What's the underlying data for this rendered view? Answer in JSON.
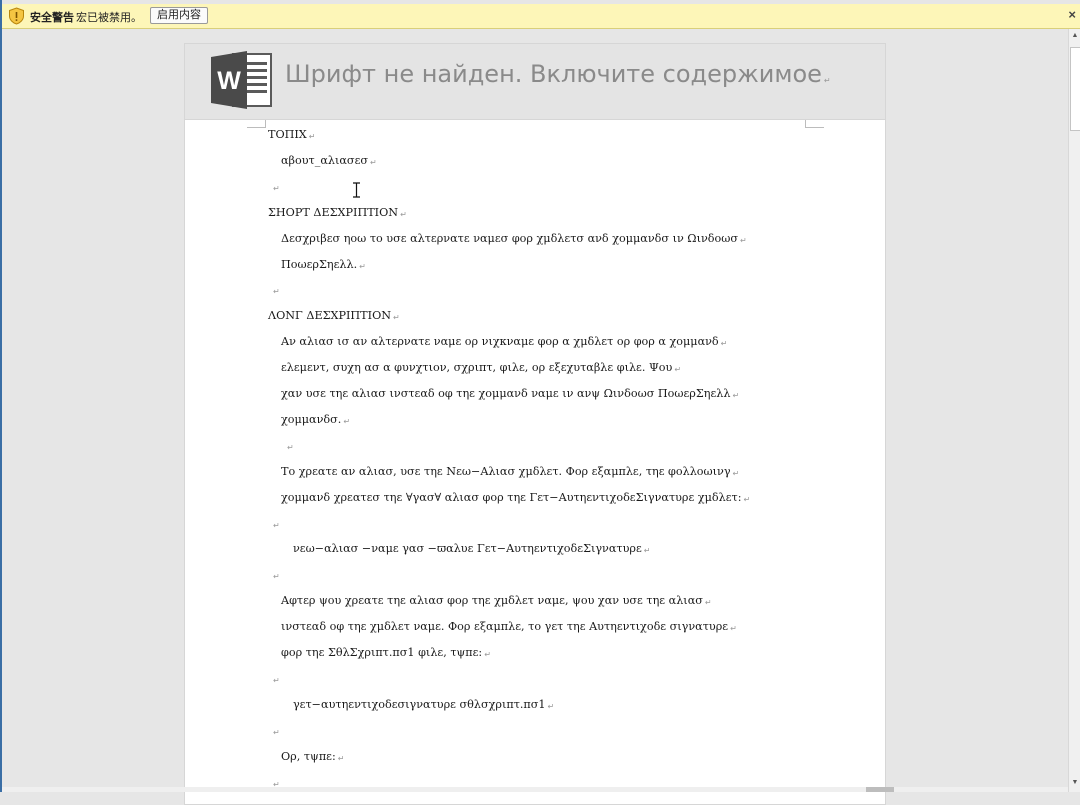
{
  "security_bar": {
    "title": "安全警告",
    "message": "宏已被禁用。",
    "enable_label": "启用内容",
    "close_glyph": "×",
    "icon": "shield-warning-icon"
  },
  "banner": {
    "text": "Шрифт не найден. Включите содержимое",
    "logo_letter": "W",
    "icon": "word-logo-icon"
  },
  "document": {
    "paragraph_mark": "↵",
    "lines": [
      "ΤΟΠΙΧ",
      "αβουτ_αλιασεσ",
      "",
      "ΣΗΟΡΤ ΔΕΣΧΡΙΠΤΙΟΝ",
      "Δεσχριβεσ ηοω το υσε αλτερνατε ναμεσ φορ χμδλετσ ανδ χομμανδσ ιν Ωινδοωσ",
      "ΠοωερΣηελλ.",
      "",
      "ΛΟΝΓ ΔΕΣΧΡΙΠΤΙΟΝ",
      "Αν αλιασ ισ αν αλτερνατε ναμε ορ νιχκναμε φορ α χμδλετ ορ φορ α χομμανδ",
      "ελεμεντ, συχη ασ α φυνχτιον, σχριπτ, φιλε, ορ εξεχυταβλε φιλε. Ψου",
      "χαν υσε τηε αλιασ ινστεαδ οφ τηε χομμανδ ναμε ιν ανψ Ωινδοωσ ΠοωερΣηελλ",
      "χομμανδσ.",
      "",
      "Το χρεατε αν αλιασ, υσε τηε Νεω−Αλιασ χμδλετ. Φορ εξαμπλε, τηε φολλοωινγ",
      "χομμανδ χρεατεσ τηε ∀γασ∀ αλιασ φορ τηε Γετ−ΑυτηεντιχοδεΣιγνατυρε χμδλετ:",
      "",
      "νεω−αλιασ −ναμε γασ −ϖαλυε Γετ−ΑυτηεντιχοδεΣιγνατυρε",
      "",
      "Αφτερ ψου χρεατε τηε αλιασ φορ τηε χμδλετ ναμε, ψου χαν υσε τηε αλιασ",
      "ινστεαδ οφ τηε χμδλετ ναμε. Φορ εξαμπλε, το γετ τηε Αυτηεντιχοδε σιγνατυρε",
      "φορ τηε ΣθλΣχριπτ.πσ1 φιλε, τψπε:",
      "",
      "γετ−αυτηεντιχοδεσιγνατυρε σθλσχριπτ.πσ1",
      "",
      "Ορ, τψπε:",
      ""
    ]
  },
  "scrollbar": {
    "up": "▲",
    "down": "▼"
  },
  "colors": {
    "security_bar_bg": "#fdf6b8",
    "page_bg": "#ffffff",
    "workspace_bg": "#e6e6e6",
    "word_blue": "#2b579a"
  }
}
